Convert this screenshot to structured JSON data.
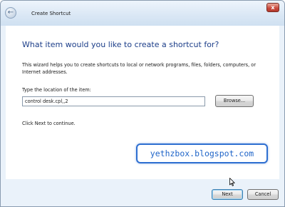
{
  "window": {
    "title": "Create Shortcut",
    "back_glyph": "←",
    "close_glyph": "x"
  },
  "wizard": {
    "heading": "What item would you like to create a shortcut for?",
    "description": "This wizard helps you to create shortcuts to local or network programs, files, folders, computers, or Internet addresses.",
    "location_label": "Type the location of the item:",
    "location_value": "control desk.cpl,,2",
    "browse_label": "Browse...",
    "continue_text": "Click Next to continue."
  },
  "watermark": {
    "text": "yethzbox.blogspot.com"
  },
  "footer": {
    "next_label": "Next",
    "cancel_label": "Cancel"
  },
  "colors": {
    "heading": "#1c3e89",
    "watermark_border": "#2e6fd1",
    "window_frame": "#eaf2fa"
  },
  "icons": {
    "back": "back-arrow-icon",
    "close": "close-icon",
    "cursor": "mouse-pointer-icon"
  }
}
